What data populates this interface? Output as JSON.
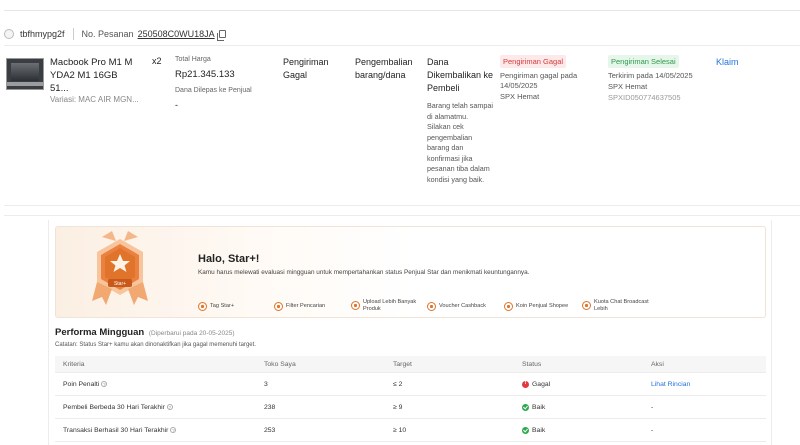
{
  "order": {
    "shop_name": "tbfhmypg2f",
    "order_no_label": "No. Pesanan",
    "order_no": "250508C0WU18JA",
    "product_name": "Macbook Pro M1 M YDA2 M1 16GB 51...",
    "variant": "Variasi: MAC AIR MGN...",
    "qty": "x2",
    "total_label": "Total Harga",
    "total_value": "Rp21.345.133",
    "released_label": "Dana Dilepas ke Penjual",
    "released_value": "-",
    "shipping_col": "Pengiriman Gagal",
    "return_col": "Pengembalian barang/dana",
    "refund_col": "Dana Dikembalikan ke Pembeli",
    "refund_note": "Barang telah sampai di alamatmu. Silakan cek pengembalian barang dan konfirmasi jika pesanan tiba dalam kondisi yang baik.",
    "fail_badge": "Pengiriman Gagal",
    "fail_text": "Pengiriman gagal pada 14/05/2025",
    "fail_carrier": "SPX Hemat",
    "done_badge": "Pengiriman Selesai",
    "done_text": "Terkirim pada 14/05/2025",
    "done_carrier": "SPX Hemat",
    "done_tracking": "SPXID050774637505",
    "claim_label": "Klaim",
    "colors": {
      "fail": "#d23b3b",
      "success": "#2e9a4a",
      "link": "#2673dd"
    }
  },
  "star": {
    "medal_label": "Star+",
    "hello": "Halo, Star+!",
    "subtitle": "Kamu harus melewati evaluasi mingguan untuk mempertahankan status Penjual Star dan menikmati keuntungannya.",
    "features": [
      "Tag Star+",
      "Filter Pencarian",
      "Upload Lebih Banyak Produk",
      "Voucher Cashback",
      "Koin Penjual Shopee",
      "Kuota Chat Broadcast Lebih"
    ],
    "accent": "#e0742a"
  },
  "performance": {
    "title": "Performa Mingguan",
    "updated": "(Diperbarui pada 20-05-2025)",
    "note": "Catatan: Status Star+ kamu akan dinonaktifkan jika gagal memenuhi target.",
    "headers": [
      "Kriteria",
      "Toko Saya",
      "Target",
      "Status",
      "Aksi"
    ],
    "rows": [
      {
        "criteria": "Poin Penalti",
        "mine": "3",
        "target": "≤ 2",
        "status": "Gagal",
        "action": "Lihat Rincian"
      },
      {
        "criteria": "Pembeli Berbeda 30 Hari Terakhir",
        "mine": "238",
        "target": "≥ 9",
        "status": "Baik",
        "action": "-"
      },
      {
        "criteria": "Transaksi Berhasil 30 Hari Terakhir",
        "mine": "253",
        "target": "≥ 10",
        "status": "Baik",
        "action": "-"
      }
    ]
  }
}
